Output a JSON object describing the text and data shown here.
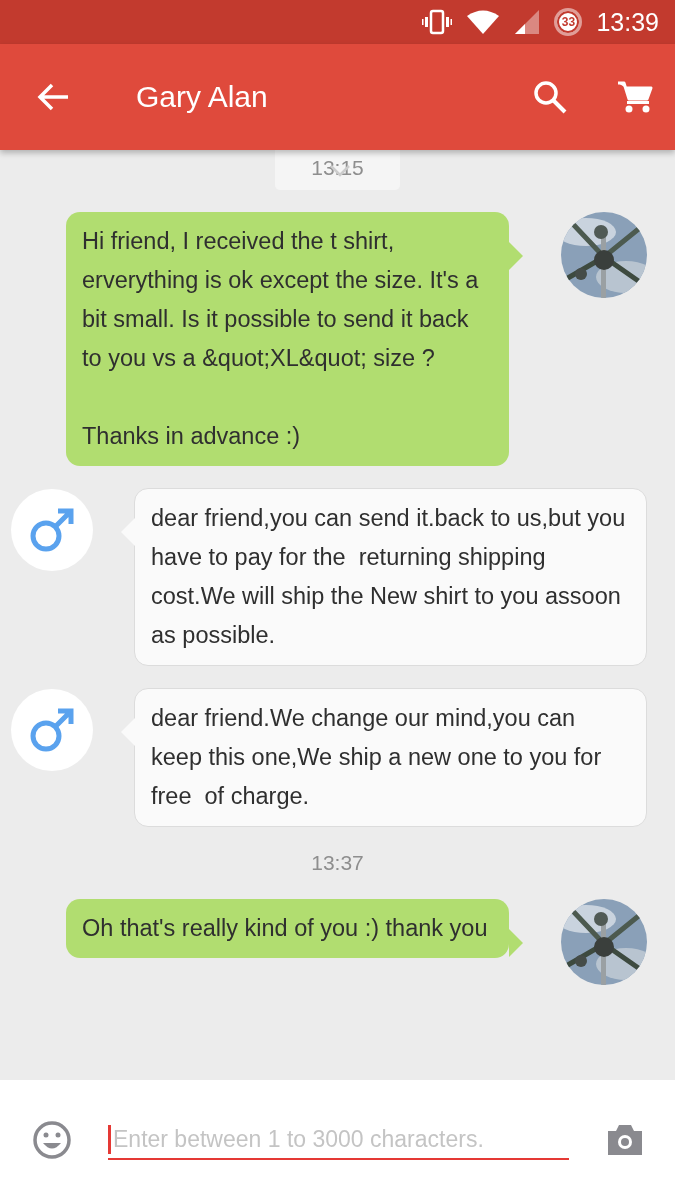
{
  "status_bar": {
    "battery": "33",
    "time": "13:39"
  },
  "app_bar": {
    "title": "Gary Alan"
  },
  "messages": [
    {
      "kind": "time",
      "text": "13:15"
    },
    {
      "kind": "sent",
      "text": "Hi friend, I received the t shirt, erverything is ok except the size. It's a bit small. Is it possible to send it back to you vs a &quot;XL&quot; size ?\n\nThanks in advance :)"
    },
    {
      "kind": "received",
      "text": "dear friend,you can send it.back to us,but you have to pay for the  returning shipping cost.We will ship the New shirt to you assoon as possible."
    },
    {
      "kind": "received",
      "text": "dear friend.We change our mind,you can keep this one,We ship a new one to you for free  of charge."
    },
    {
      "kind": "time",
      "text": "13:37"
    },
    {
      "kind": "sent",
      "text": "Oh that's really kind of you :) thank you"
    }
  ],
  "composer": {
    "placeholder": "Enter between 1 to 3000 characters."
  }
}
